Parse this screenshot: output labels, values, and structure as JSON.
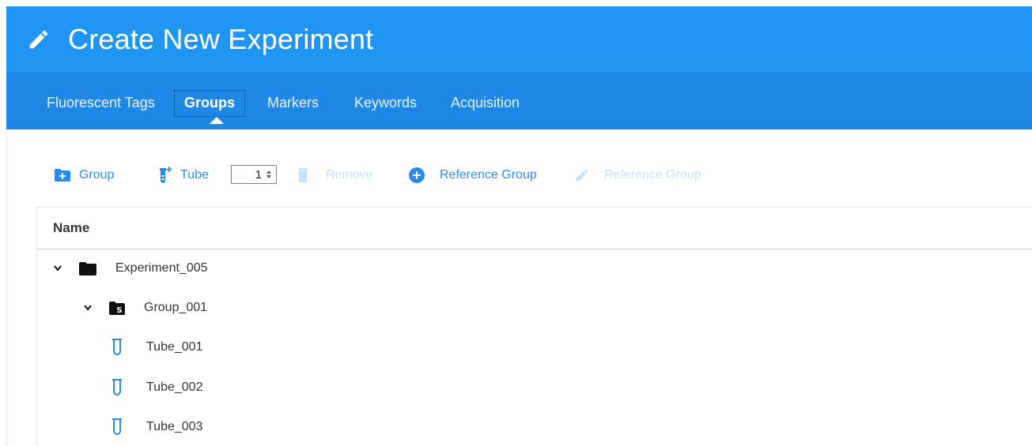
{
  "header": {
    "title": "Create New Experiment",
    "icon": "pencil-icon"
  },
  "tabs": [
    {
      "label": "Fluorescent Tags",
      "active": false
    },
    {
      "label": "Groups",
      "active": true
    },
    {
      "label": "Markers",
      "active": false
    },
    {
      "label": "Keywords",
      "active": false
    },
    {
      "label": "Acquisition",
      "active": false
    }
  ],
  "toolbar": {
    "add_group": {
      "label": "Group",
      "icon": "folder-plus-icon",
      "enabled": true
    },
    "add_tube": {
      "label": "Tube",
      "icon": "tube-plus-icon",
      "enabled": true
    },
    "tube_count": "1",
    "remove": {
      "label": "Remove",
      "icon": "trash-icon",
      "enabled": false
    },
    "add_reference_group": {
      "label": "Reference Group",
      "icon": "plus-circle-icon",
      "enabled": true
    },
    "edit_reference_group": {
      "label": "Reference Group",
      "icon": "pencil-icon",
      "enabled": false
    }
  },
  "grid": {
    "column_header": "Name",
    "rows": [
      {
        "label": "Experiment_005",
        "type": "experiment",
        "icon": "folder-icon",
        "expanded": true
      },
      {
        "label": "Group_001",
        "type": "group",
        "icon": "folder-s-icon",
        "expanded": true
      },
      {
        "label": "Tube_001",
        "type": "tube",
        "icon": "tube-icon"
      },
      {
        "label": "Tube_002",
        "type": "tube",
        "icon": "tube-icon"
      },
      {
        "label": "Tube_003",
        "type": "tube",
        "icon": "tube-icon"
      }
    ]
  },
  "colors": {
    "title_bar": "#2195f3",
    "tab_bar": "#1f88e5",
    "accent": "#2a8af0",
    "disabled": "#c8e1fb",
    "tube_icon": "#2a8af0"
  }
}
